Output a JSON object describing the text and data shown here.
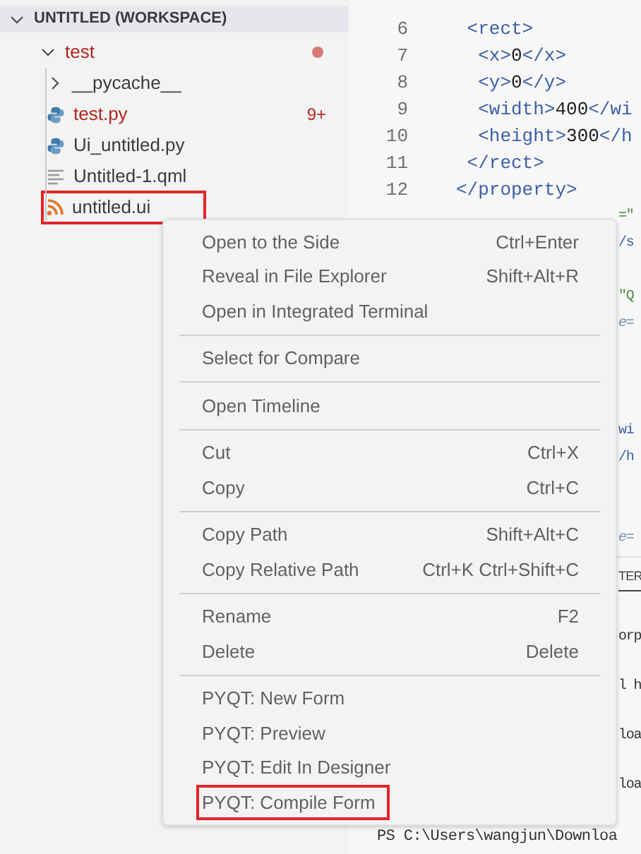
{
  "explorer": {
    "workspace_title": "UNTITLED (WORKSPACE)",
    "expanded": true,
    "tree": [
      {
        "name": "test",
        "kind": "folder",
        "expanded": true,
        "error": true,
        "dot": true,
        "highlighted": false,
        "children": [
          {
            "name": "__pycache__",
            "kind": "folder",
            "expanded": false,
            "error": false,
            "highlighted": false
          },
          {
            "name": "test.py",
            "kind": "python",
            "error": true,
            "badge": "9+",
            "highlighted": false
          },
          {
            "name": "Ui_untitled.py",
            "kind": "python",
            "error": false,
            "highlighted": false
          },
          {
            "name": "Untitled-1.qml",
            "kind": "text",
            "error": false,
            "highlighted": false
          },
          {
            "name": "untitled.ui",
            "kind": "xml",
            "error": false,
            "highlighted": true
          }
        ]
      }
    ]
  },
  "editor": {
    "lines": [
      {
        "number": "6",
        "segments": [
          {
            "text": " <rect>",
            "kind": "tag"
          }
        ]
      },
      {
        "number": "7",
        "segments": [
          {
            "text": "  <x>",
            "kind": "tag"
          },
          {
            "text": "0",
            "kind": "text"
          },
          {
            "text": "</x>",
            "kind": "tag"
          }
        ]
      },
      {
        "number": "8",
        "segments": [
          {
            "text": "  <y>",
            "kind": "tag"
          },
          {
            "text": "0",
            "kind": "text"
          },
          {
            "text": "</y>",
            "kind": "tag"
          }
        ]
      },
      {
        "number": "9",
        "segments": [
          {
            "text": "  <width>",
            "kind": "tag"
          },
          {
            "text": "400",
            "kind": "text"
          },
          {
            "text": "</wi",
            "kind": "tag"
          }
        ]
      },
      {
        "number": "10",
        "segments": [
          {
            "text": "  <height>",
            "kind": "tag"
          },
          {
            "text": "300",
            "kind": "text"
          },
          {
            "text": "</h",
            "kind": "tag"
          }
        ]
      },
      {
        "number": "11",
        "segments": [
          {
            "text": " </rect>",
            "kind": "tag"
          }
        ]
      },
      {
        "number": "12",
        "segments": [
          {
            "text": "</property>",
            "kind": "tag"
          }
        ]
      }
    ],
    "clipped_fragments": [
      {
        "text": "=\"",
        "kind": "string"
      },
      {
        "text": "/s",
        "kind": "tag"
      },
      {
        "text": "\"Q",
        "kind": "string"
      },
      {
        "text": "e=",
        "kind": "attr"
      },
      {
        "text": "wi",
        "kind": "tag"
      },
      {
        "text": "/h",
        "kind": "tag"
      },
      {
        "text": "e=",
        "kind": "attr"
      }
    ]
  },
  "panel": {
    "tab_fragment": "TER",
    "tab_selected": true,
    "terminal_fragments": [
      "orp",
      "l h",
      "loa",
      "loa"
    ],
    "prompt_line": "PS C:\\Users\\wangjun\\Downloa"
  },
  "context_menu": {
    "groups": [
      [
        {
          "label": "Open to the Side",
          "shortcut": "Ctrl+Enter",
          "highlighted": false
        },
        {
          "label": "Reveal in File Explorer",
          "shortcut": "Shift+Alt+R",
          "highlighted": false
        },
        {
          "label": "Open in Integrated Terminal",
          "highlighted": false
        }
      ],
      [
        {
          "label": "Select for Compare",
          "highlighted": false
        }
      ],
      [
        {
          "label": "Open Timeline",
          "highlighted": false
        }
      ],
      [
        {
          "label": "Cut",
          "shortcut": "Ctrl+X",
          "highlighted": false
        },
        {
          "label": "Copy",
          "shortcut": "Ctrl+C",
          "highlighted": false
        }
      ],
      [
        {
          "label": "Copy Path",
          "shortcut": "Shift+Alt+C",
          "highlighted": false
        },
        {
          "label": "Copy Relative Path",
          "shortcut": "Ctrl+K Ctrl+Shift+C",
          "highlighted": false
        }
      ],
      [
        {
          "label": "Rename",
          "shortcut": "F2",
          "highlighted": false
        },
        {
          "label": "Delete",
          "shortcut": "Delete",
          "highlighted": false
        }
      ],
      [
        {
          "label": "PYQT: New Form",
          "highlighted": false
        },
        {
          "label": "PYQT: Preview",
          "highlighted": false
        },
        {
          "label": "PYQT: Edit In Designer",
          "highlighted": false
        },
        {
          "label": "PYQT: Compile Form",
          "highlighted": true
        }
      ]
    ]
  }
}
